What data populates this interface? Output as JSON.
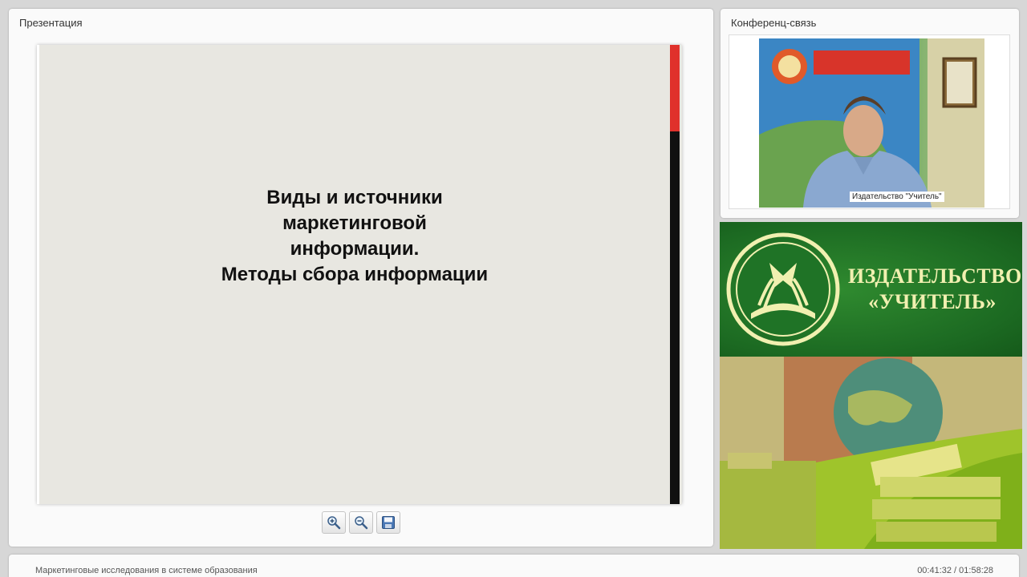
{
  "presentation": {
    "title": "Презентация",
    "slide_title_lines": [
      "Виды и источники",
      "маркетинговой",
      "информации.",
      "Методы сбора информации"
    ],
    "toolbar": [
      {
        "name": "zoom-in-button",
        "icon": "zoom-in-icon"
      },
      {
        "name": "zoom-out-button",
        "icon": "zoom-out-icon"
      },
      {
        "name": "save-button",
        "icon": "floppy-disk-icon"
      }
    ]
  },
  "conference": {
    "title": "Конференц-связь",
    "caption": "Издательство \"Учитель\""
  },
  "banner": {
    "line1": "ИЗДАТЕЛЬСТВО",
    "line2": "«УЧИТЕЛЬ»",
    "background_color": "#1c6a22",
    "text_color": "#f1f0b0"
  },
  "footer": {
    "course_title": "Маркетинговые исследования в системе образования",
    "time": "00:41:32 / 01:58:28"
  }
}
